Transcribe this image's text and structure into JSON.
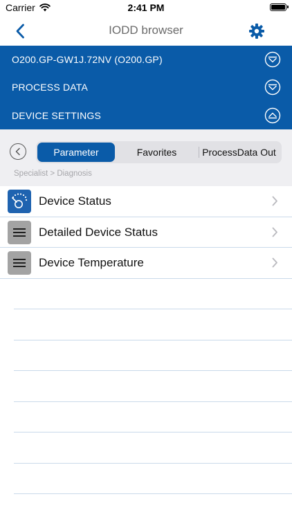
{
  "status_bar": {
    "carrier": "Carrier",
    "time": "2:41 PM"
  },
  "nav": {
    "title": "IODD browser"
  },
  "accordion": {
    "rows": [
      {
        "label": "O200.GP-GW1J.72NV (O200.GP)",
        "state": "collapsed"
      },
      {
        "label": "PROCESS DATA",
        "state": "collapsed"
      },
      {
        "label": "DEVICE SETTINGS",
        "state": "expanded"
      }
    ]
  },
  "tabs": {
    "items": [
      "Parameter",
      "Favorites",
      "ProcessData Out"
    ],
    "selected": "Parameter"
  },
  "breadcrumb": "Specialist > Diagnosis",
  "list": {
    "items": [
      {
        "label": "Device Status",
        "icon": "gauge-icon"
      },
      {
        "label": "Detailed Device Status",
        "icon": "menu-icon"
      },
      {
        "label": "Device Temperature",
        "icon": "menu-icon"
      }
    ]
  },
  "colors": {
    "brand_blue": "#0a5ba8",
    "icon_blue": "#1f63b0",
    "icon_grey": "#a3a3a3",
    "band_grey": "#efeff2",
    "separator": "#c9d9ea"
  }
}
